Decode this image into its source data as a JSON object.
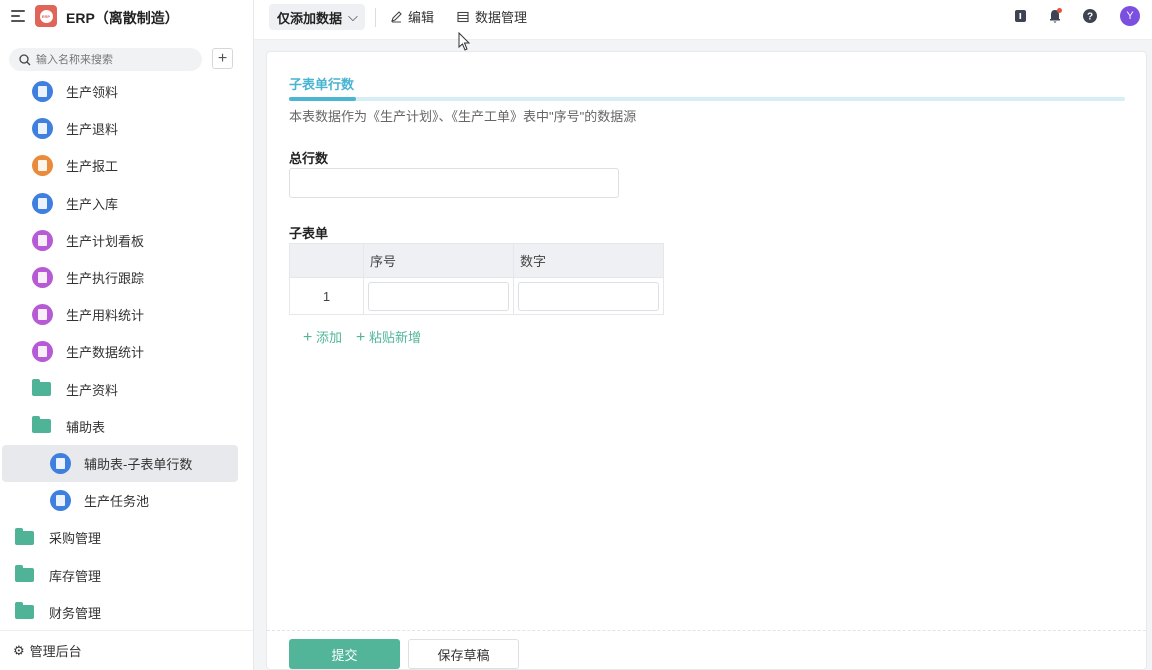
{
  "app": {
    "title": "ERP（离散制造）",
    "logo_text": "ERP"
  },
  "search": {
    "placeholder": "输入名称来搜索",
    "add": "+"
  },
  "sidebar": {
    "items": [
      {
        "label": "生产领料",
        "icon": "form-icon",
        "color": "#3f7fe0",
        "level": 1
      },
      {
        "label": "生产退料",
        "icon": "form-icon",
        "color": "#3f7fe0",
        "level": 1
      },
      {
        "label": "生产报工",
        "icon": "report-icon",
        "color": "#ea8a3b",
        "level": 1
      },
      {
        "label": "生产入库",
        "icon": "form-icon",
        "color": "#3f7fe0",
        "level": 1
      },
      {
        "label": "生产计划看板",
        "icon": "dashboard-icon",
        "color": "#b65ad6",
        "level": 1
      },
      {
        "label": "生产执行跟踪",
        "icon": "dashboard-icon",
        "color": "#b65ad6",
        "level": 1
      },
      {
        "label": "生产用料统计",
        "icon": "dashboard-icon",
        "color": "#b65ad6",
        "level": 1
      },
      {
        "label": "生产数据统计",
        "icon": "dashboard-icon",
        "color": "#b65ad6",
        "level": 1
      },
      {
        "label": "生产资料",
        "icon": "folder-icon",
        "level": 1
      },
      {
        "label": "辅助表",
        "icon": "folder-icon",
        "level": 1
      },
      {
        "label": "辅助表-子表单行数",
        "icon": "tag-icon",
        "color": "#3f7fe0",
        "level": 2,
        "selected": true
      },
      {
        "label": "生产任务池",
        "icon": "form-icon",
        "color": "#3f7fe0",
        "level": 2
      },
      {
        "label": "采购管理",
        "icon": "folder-icon",
        "level": 0
      },
      {
        "label": "库存管理",
        "icon": "folder-icon",
        "level": 0
      },
      {
        "label": "财务管理",
        "icon": "folder-icon",
        "level": 0
      }
    ],
    "footer": "管理后台"
  },
  "toolbar": {
    "mode": "仅添加数据",
    "edit": "编辑",
    "data_manage": "数据管理",
    "avatar": "Y"
  },
  "form": {
    "title": "子表单行数",
    "progress": 0.08,
    "description": "本表数据作为《生产计划》、《生产工单》表中\"序号\"的数据源",
    "total_label": "总行数",
    "total_value": "",
    "subform_label": "子表单",
    "columns": [
      "序号",
      "数字"
    ],
    "rows": [
      {
        "index": "1",
        "seq": "",
        "num": ""
      }
    ],
    "add": "添加",
    "paste_add": "粘贴新增",
    "submit": "提交",
    "save_draft": "保存草稿"
  },
  "colors": {
    "accent": "#52b59a",
    "title": "#4ab3d2",
    "avatar": "#7b4fe0"
  }
}
